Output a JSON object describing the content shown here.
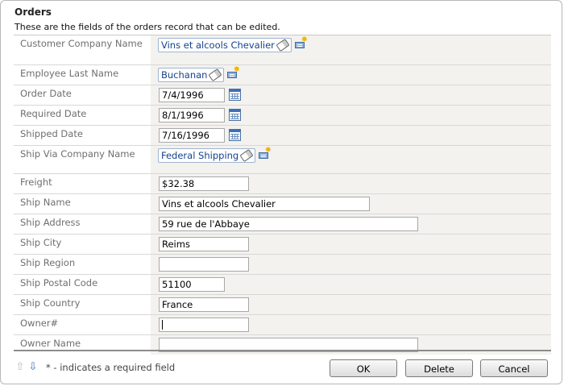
{
  "header": {
    "title": "Orders",
    "description": "These are the fields of the orders record that can be edited."
  },
  "fields": {
    "customer_company_name": {
      "label": "Customer Company Name",
      "value": "Vins et alcools Chevalier"
    },
    "employee_last_name": {
      "label": "Employee Last Name",
      "value": "Buchanan"
    },
    "order_date": {
      "label": "Order Date",
      "value": "7/4/1996"
    },
    "required_date": {
      "label": "Required Date",
      "value": "8/1/1996"
    },
    "shipped_date": {
      "label": "Shipped Date",
      "value": "7/16/1996"
    },
    "ship_via_company_name": {
      "label": "Ship Via Company Name",
      "value": "Federal Shipping"
    },
    "freight": {
      "label": "Freight",
      "value": "$32.38"
    },
    "ship_name": {
      "label": "Ship Name",
      "value": "Vins et alcools Chevalier"
    },
    "ship_address": {
      "label": "Ship Address",
      "value": "59 rue de l'Abbaye"
    },
    "ship_city": {
      "label": "Ship City",
      "value": "Reims"
    },
    "ship_region": {
      "label": "Ship Region",
      "value": ""
    },
    "ship_postal_code": {
      "label": "Ship Postal Code",
      "value": "51100"
    },
    "ship_country": {
      "label": "Ship Country",
      "value": "France"
    },
    "owner_num": {
      "label": "Owner#",
      "value": ""
    },
    "owner_name": {
      "label": "Owner Name",
      "value": ""
    }
  },
  "footer": {
    "required_note": "* - indicates a required field",
    "ok_label": "OK",
    "delete_label": "Delete",
    "cancel_label": "Cancel"
  },
  "icons": {
    "clear": "eraser-icon",
    "new_lookup": "new-item-icon",
    "calendar": "calendar-icon",
    "nav_up": "arrow-up-icon",
    "nav_down": "arrow-down-icon"
  },
  "colors": {
    "lookup_text": "#15428b",
    "label_text": "#6f6f6f",
    "value_background": "#f3f2ef"
  }
}
